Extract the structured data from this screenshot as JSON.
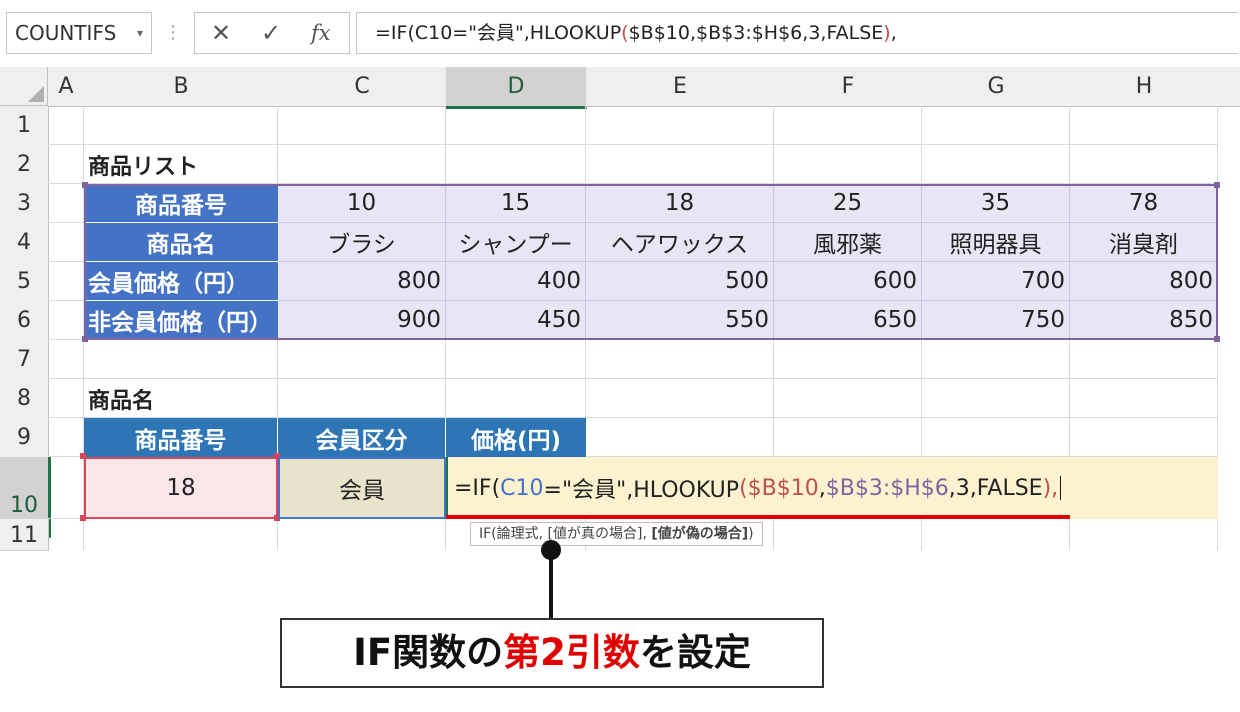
{
  "name_box": {
    "value": "COUNTIFS",
    "dropdown_icon": "chevron-down-icon"
  },
  "formula_bar": {
    "cancel_icon": "✕",
    "enter_icon": "✓",
    "function_icon": "fx",
    "formula_parts": [
      {
        "text": "=IF(C10=\"会員\",HLOOKUP(",
        "color": "#222222"
      },
      {
        "text": "$B$10,$B$3:$H$6,3,FALSE",
        "color": "#222222"
      },
      {
        "text": "),",
        "color": "#c0504d"
      }
    ],
    "formula_prefix": "=IF(C10=\"会員\",HLOOKUP",
    "formula_paren": "(",
    "formula_args": "$B$10,$B$3:$H$6,3,FALSE",
    "formula_close": ")",
    "formula_comma": ","
  },
  "columns": [
    "A",
    "B",
    "C",
    "D",
    "E",
    "F",
    "G",
    "H"
  ],
  "rows": [
    "1",
    "2",
    "3",
    "4",
    "5",
    "6",
    "7",
    "8",
    "9",
    "10",
    "11"
  ],
  "selected_column": "D",
  "selected_row": "10",
  "product_list": {
    "title": "商品リスト",
    "row_labels": [
      "商品番号",
      "商品名",
      "会員価格（円）",
      "非会員価格（円）"
    ],
    "product_numbers": [
      "10",
      "15",
      "18",
      "25",
      "35",
      "78"
    ],
    "product_names": [
      "ブラシ",
      "シャンプー",
      "ヘアワックス",
      "風邪薬",
      "照明器具",
      "消臭剤"
    ],
    "member_prices": [
      "800",
      "400",
      "500",
      "600",
      "700",
      "800"
    ],
    "nonmember_prices": [
      "900",
      "450",
      "550",
      "650",
      "750",
      "850"
    ]
  },
  "lookup": {
    "title": "商品名",
    "headers": [
      "商品番号",
      "会員区分",
      "価格(円)"
    ],
    "product_number": "18",
    "member_type": "会員",
    "edit_formula": {
      "p1": "=IF(",
      "p2": "C10",
      "p3": "=\"会員\",HLOOKUP",
      "p4": "(",
      "p5": "$B$10",
      "p6": ",",
      "p7": "$B$3:$H$6",
      "p8": ",3,FALSE",
      "p9": "),"
    }
  },
  "tooltip": {
    "normal": "IF(論理式, [値が真の場合], ",
    "bold": "[値が偽の場合]",
    "end": ")"
  },
  "callout": {
    "part1": "IF関数の",
    "part2": "第2引数",
    "part3": "を設定"
  },
  "colors": {
    "header_blue": "#4472c4",
    "header_dark": "#2e75b6",
    "lavender": "#e7e6f5",
    "accent_red": "#e00000",
    "excel_green": "#217346",
    "ref_blue": "#4472c4",
    "ref_red": "#c0504d",
    "ref_purple": "#8064a2"
  }
}
